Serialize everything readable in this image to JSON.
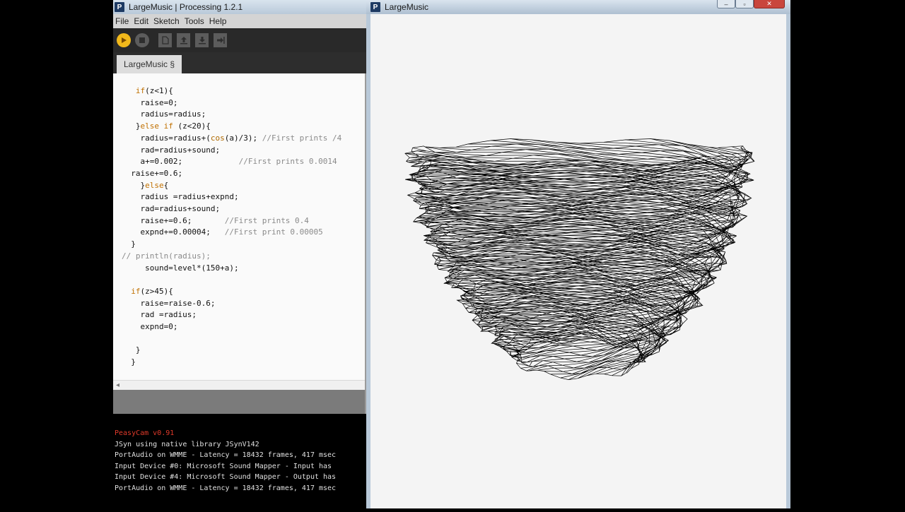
{
  "ide": {
    "title": "LargeMusic | Processing 1.2.1",
    "menu": [
      "File",
      "Edit",
      "Sketch",
      "Tools",
      "Help"
    ],
    "tab_label": "LargeMusic §",
    "code_lines": [
      {
        "indent": "   ",
        "parts": [
          [
            "kw",
            "if"
          ],
          [
            "",
            "(z<1){"
          ]
        ]
      },
      {
        "indent": "    ",
        "parts": [
          [
            "",
            "raise=0;"
          ]
        ]
      },
      {
        "indent": "    ",
        "parts": [
          [
            "",
            "radius=radius;"
          ]
        ]
      },
      {
        "indent": "   ",
        "parts": [
          [
            "",
            "}"
          ],
          [
            "kw",
            "else if"
          ],
          [
            "",
            " (z<20){"
          ]
        ]
      },
      {
        "indent": "    ",
        "parts": [
          [
            "",
            "radius=radius+("
          ],
          [
            "fn",
            "cos"
          ],
          [
            "",
            "(a)/3); "
          ],
          [
            "cm",
            "//First prints /4"
          ]
        ]
      },
      {
        "indent": "    ",
        "parts": [
          [
            "",
            "rad=radius+sound;"
          ]
        ]
      },
      {
        "indent": "    ",
        "parts": [
          [
            "",
            "a+=0.002;            "
          ],
          [
            "cm",
            "//First prints 0.0014"
          ]
        ]
      },
      {
        "indent": "  ",
        "parts": [
          [
            "",
            "raise+=0.6;"
          ]
        ]
      },
      {
        "indent": "    ",
        "parts": [
          [
            "",
            "}"
          ],
          [
            "kw",
            "else"
          ],
          [
            "",
            "{"
          ]
        ]
      },
      {
        "indent": "    ",
        "parts": [
          [
            "",
            "radius =radius+expnd;"
          ]
        ]
      },
      {
        "indent": "    ",
        "parts": [
          [
            "",
            "rad=radius+sound;"
          ]
        ]
      },
      {
        "indent": "    ",
        "parts": [
          [
            "",
            "raise+=0.6;       "
          ],
          [
            "cm",
            "//First prints 0.4"
          ]
        ]
      },
      {
        "indent": "    ",
        "parts": [
          [
            "",
            "expnd+=0.00004;   "
          ],
          [
            "cm",
            "//First print 0.00005"
          ]
        ]
      },
      {
        "indent": "  ",
        "parts": [
          [
            "",
            "}"
          ]
        ]
      },
      {
        "indent": "",
        "parts": [
          [
            "cm",
            "// println(radius);"
          ]
        ]
      },
      {
        "indent": "     ",
        "parts": [
          [
            "",
            "sound=level*(150+a);"
          ]
        ]
      },
      {
        "indent": "",
        "parts": [
          [
            "",
            ""
          ]
        ]
      },
      {
        "indent": "  ",
        "parts": [
          [
            "kw",
            "if"
          ],
          [
            "",
            "(z>45){"
          ]
        ]
      },
      {
        "indent": "    ",
        "parts": [
          [
            "",
            "raise=raise-0.6;"
          ]
        ]
      },
      {
        "indent": "    ",
        "parts": [
          [
            "",
            "rad =radius;"
          ]
        ]
      },
      {
        "indent": "    ",
        "parts": [
          [
            "",
            "expnd=0;"
          ]
        ]
      },
      {
        "indent": "",
        "parts": [
          [
            "",
            ""
          ]
        ]
      },
      {
        "indent": "   ",
        "parts": [
          [
            "",
            "}"
          ]
        ]
      },
      {
        "indent": "  ",
        "parts": [
          [
            "",
            "}"
          ]
        ]
      }
    ],
    "console_lines": [
      {
        "text": "PeasyCam v0.91",
        "red": true
      },
      {
        "text": "JSyn using native library JSynV142",
        "red": false
      },
      {
        "text": "PortAudio on WMME - Latency = 18432 frames, 417 msec",
        "red": false
      },
      {
        "text": "Input Device #0: Microsoft Sound Mapper - Input has",
        "red": false
      },
      {
        "text": "Input Device #4: Microsoft Sound Mapper - Output has",
        "red": false
      },
      {
        "text": "PortAudio on WMME - Latency = 18432 frames, 417 msec",
        "red": false
      }
    ]
  },
  "sketch": {
    "title": "LargeMusic"
  },
  "colors": {
    "play_button": "#f2b91b",
    "keyword": "#c07000",
    "comment": "#8a8a8a",
    "console_error": "#e03a2a"
  }
}
